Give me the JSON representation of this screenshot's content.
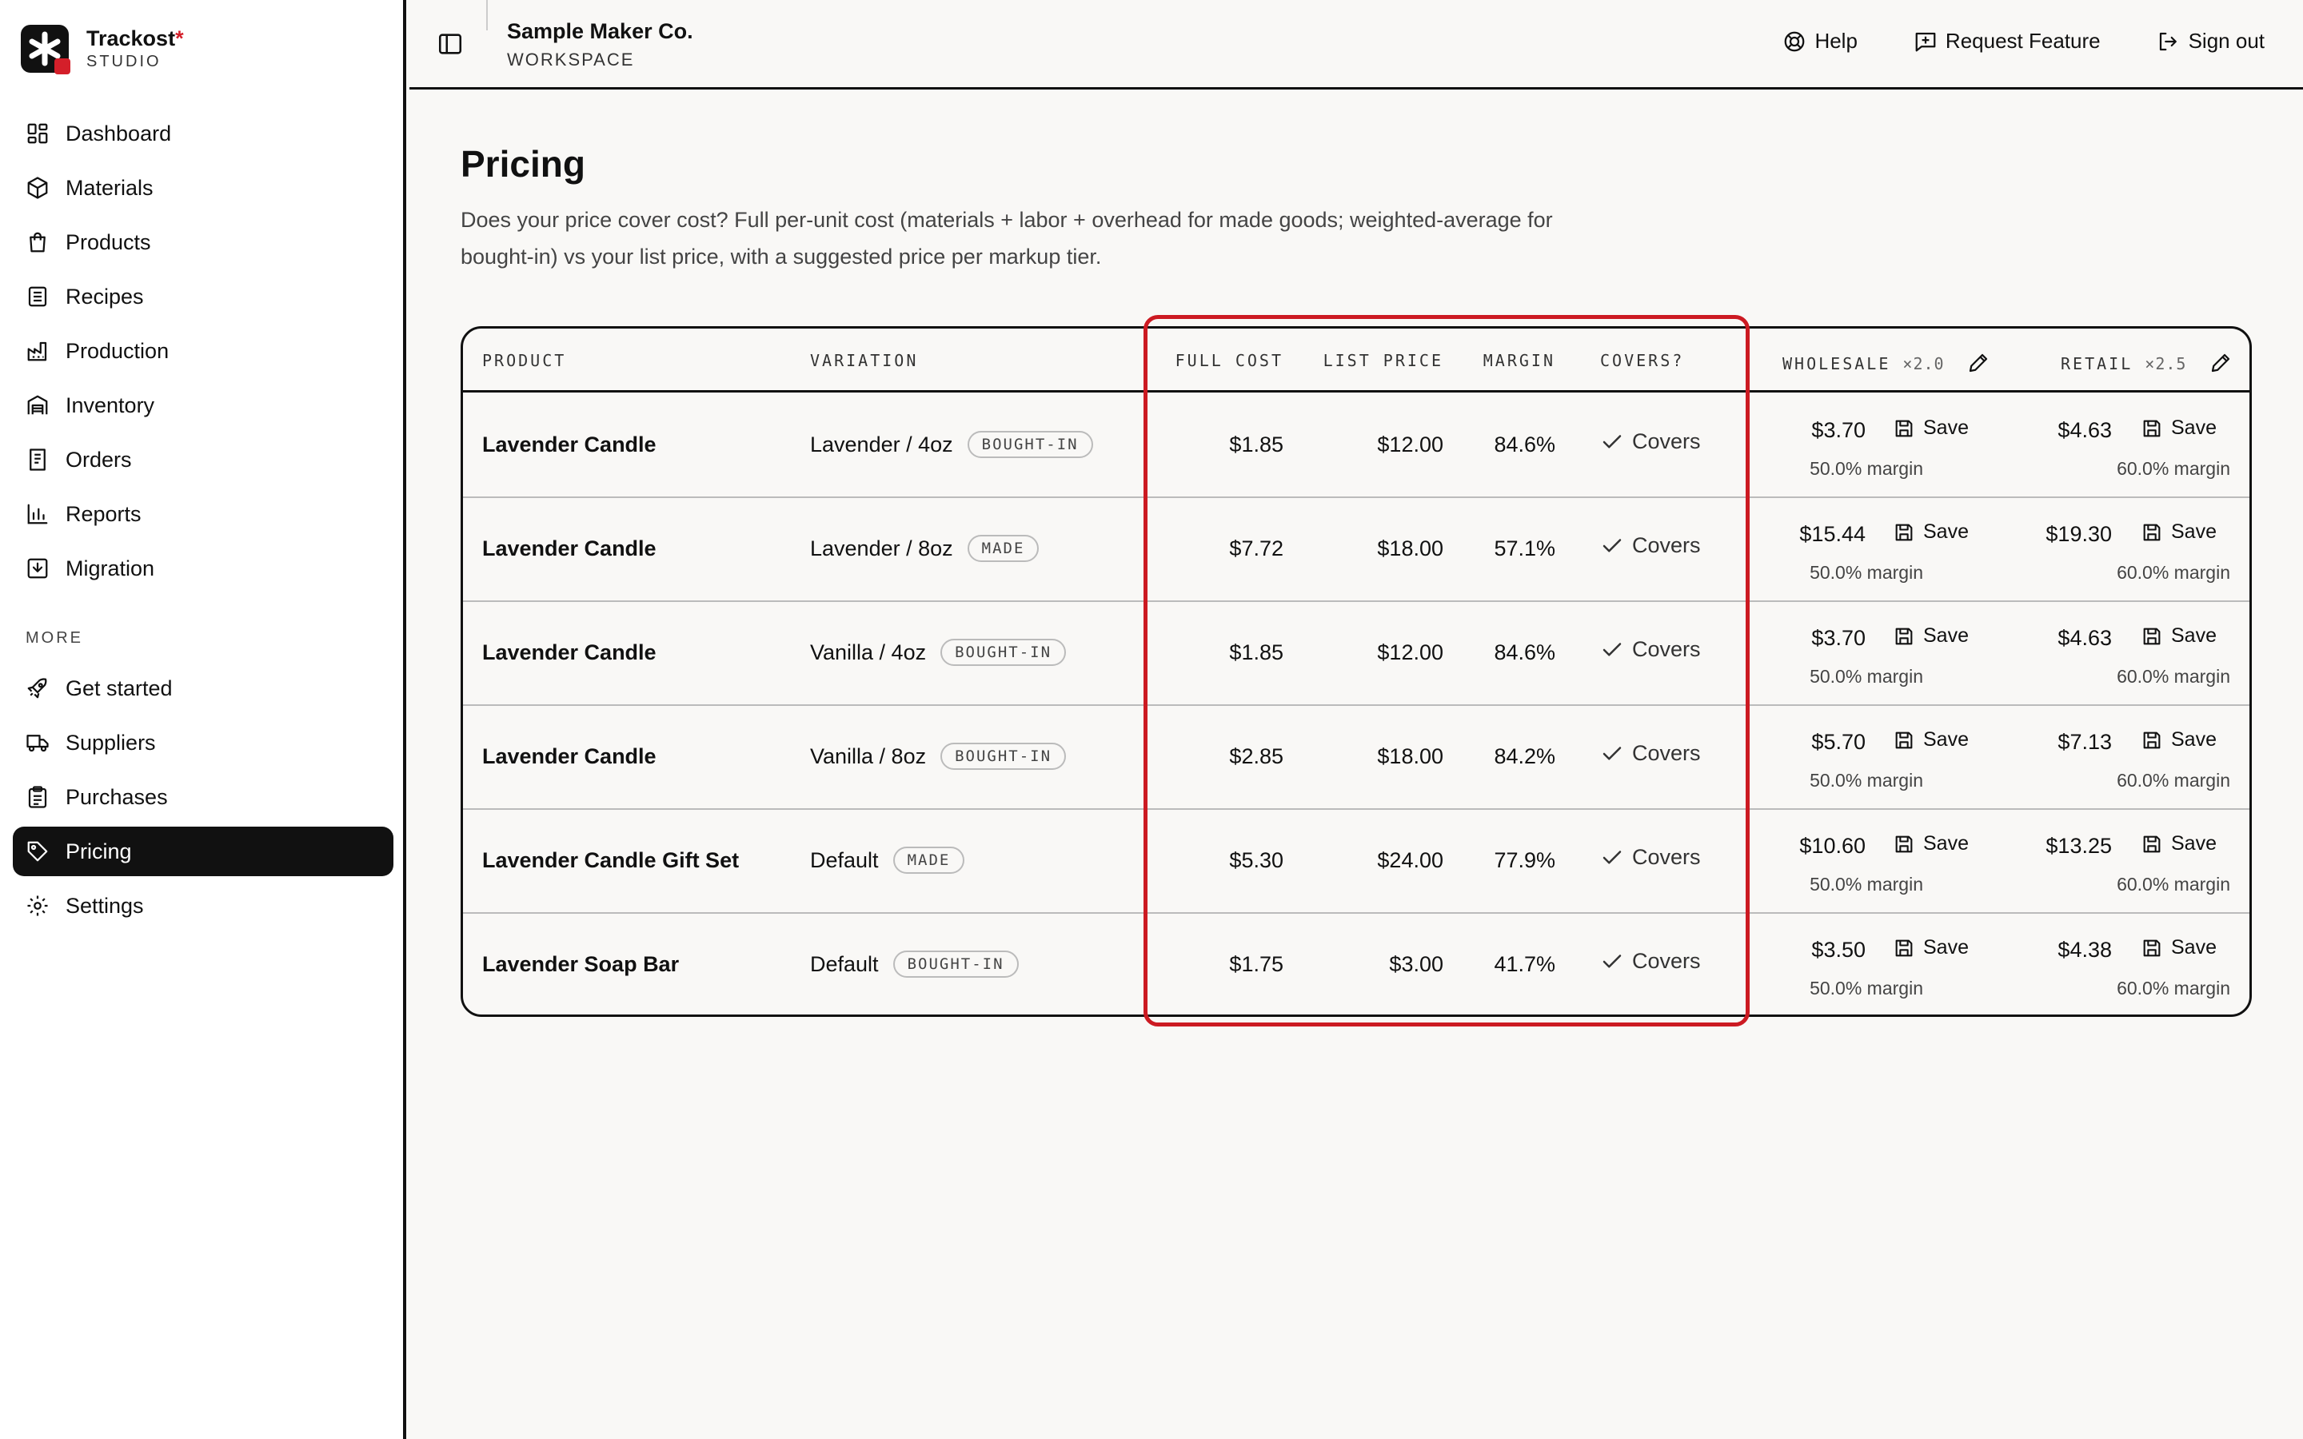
{
  "brand": {
    "name": "Trackost",
    "star": "*",
    "sub": "STUDIO"
  },
  "sidebar": {
    "items": [
      {
        "label": "Dashboard",
        "icon": "dashboard-icon"
      },
      {
        "label": "Materials",
        "icon": "box-icon"
      },
      {
        "label": "Products",
        "icon": "bag-icon"
      },
      {
        "label": "Recipes",
        "icon": "list-icon"
      },
      {
        "label": "Production",
        "icon": "factory-icon"
      },
      {
        "label": "Inventory",
        "icon": "warehouse-icon"
      },
      {
        "label": "Orders",
        "icon": "receipt-icon"
      },
      {
        "label": "Reports",
        "icon": "bar-chart-icon"
      },
      {
        "label": "Migration",
        "icon": "import-icon"
      }
    ],
    "more_label": "MORE",
    "more_items": [
      {
        "label": "Get started",
        "icon": "rocket-icon"
      },
      {
        "label": "Suppliers",
        "icon": "truck-icon"
      },
      {
        "label": "Purchases",
        "icon": "clipboard-icon"
      },
      {
        "label": "Pricing",
        "icon": "tag-icon",
        "active": true
      },
      {
        "label": "Settings",
        "icon": "gear-icon"
      }
    ]
  },
  "header": {
    "workspace_name": "Sample Maker Co.",
    "workspace_sub": "WORKSPACE",
    "help": "Help",
    "request_feature": "Request Feature",
    "sign_out": "Sign out"
  },
  "page": {
    "title": "Pricing",
    "description": "Does your price cover cost? Full per-unit cost (materials + labor + overhead for made goods; weighted-average for bought-in) vs your list price, with a suggested price per markup tier."
  },
  "table": {
    "columns": {
      "product": "PRODUCT",
      "variation": "VARIATION",
      "full_cost": "FULL COST",
      "list_price": "LIST PRICE",
      "margin": "MARGIN",
      "covers": "COVERS?",
      "wholesale": "WHOLESALE",
      "wholesale_mult": "×2.0",
      "retail": "RETAIL",
      "retail_mult": "×2.5"
    },
    "save_label": "Save",
    "rows": [
      {
        "product": "Lavender Candle",
        "variation": "Lavender / 4oz",
        "type": "BOUGHT-IN",
        "full_cost": "$1.85",
        "list_price": "$12.00",
        "margin": "84.6%",
        "covers": "Covers",
        "wholesale": "$3.70",
        "wholesale_margin": "50.0% margin",
        "retail": "$4.63",
        "retail_margin": "60.0% margin"
      },
      {
        "product": "Lavender Candle",
        "variation": "Lavender / 8oz",
        "type": "MADE",
        "full_cost": "$7.72",
        "list_price": "$18.00",
        "margin": "57.1%",
        "covers": "Covers",
        "wholesale": "$15.44",
        "wholesale_margin": "50.0% margin",
        "retail": "$19.30",
        "retail_margin": "60.0% margin"
      },
      {
        "product": "Lavender Candle",
        "variation": "Vanilla / 4oz",
        "type": "BOUGHT-IN",
        "full_cost": "$1.85",
        "list_price": "$12.00",
        "margin": "84.6%",
        "covers": "Covers",
        "wholesale": "$3.70",
        "wholesale_margin": "50.0% margin",
        "retail": "$4.63",
        "retail_margin": "60.0% margin"
      },
      {
        "product": "Lavender Candle",
        "variation": "Vanilla / 8oz",
        "type": "BOUGHT-IN",
        "full_cost": "$2.85",
        "list_price": "$18.00",
        "margin": "84.2%",
        "covers": "Covers",
        "wholesale": "$5.70",
        "wholesale_margin": "50.0% margin",
        "retail": "$7.13",
        "retail_margin": "60.0% margin"
      },
      {
        "product": "Lavender Candle Gift Set",
        "variation": "Default",
        "type": "MADE",
        "full_cost": "$5.30",
        "list_price": "$24.00",
        "margin": "77.9%",
        "covers": "Covers",
        "wholesale": "$10.60",
        "wholesale_margin": "50.0% margin",
        "retail": "$13.25",
        "retail_margin": "60.0% margin"
      },
      {
        "product": "Lavender Soap Bar",
        "variation": "Default",
        "type": "BOUGHT-IN",
        "full_cost": "$1.75",
        "list_price": "$3.00",
        "margin": "41.7%",
        "covers": "Covers",
        "wholesale": "$3.50",
        "wholesale_margin": "50.0% margin",
        "retail": "$4.38",
        "retail_margin": "60.0% margin"
      }
    ]
  },
  "colors": {
    "accent": "#111111",
    "brand_red": "#d41f2a",
    "highlight": "#cc1a22",
    "background": "#f9f8f6"
  }
}
